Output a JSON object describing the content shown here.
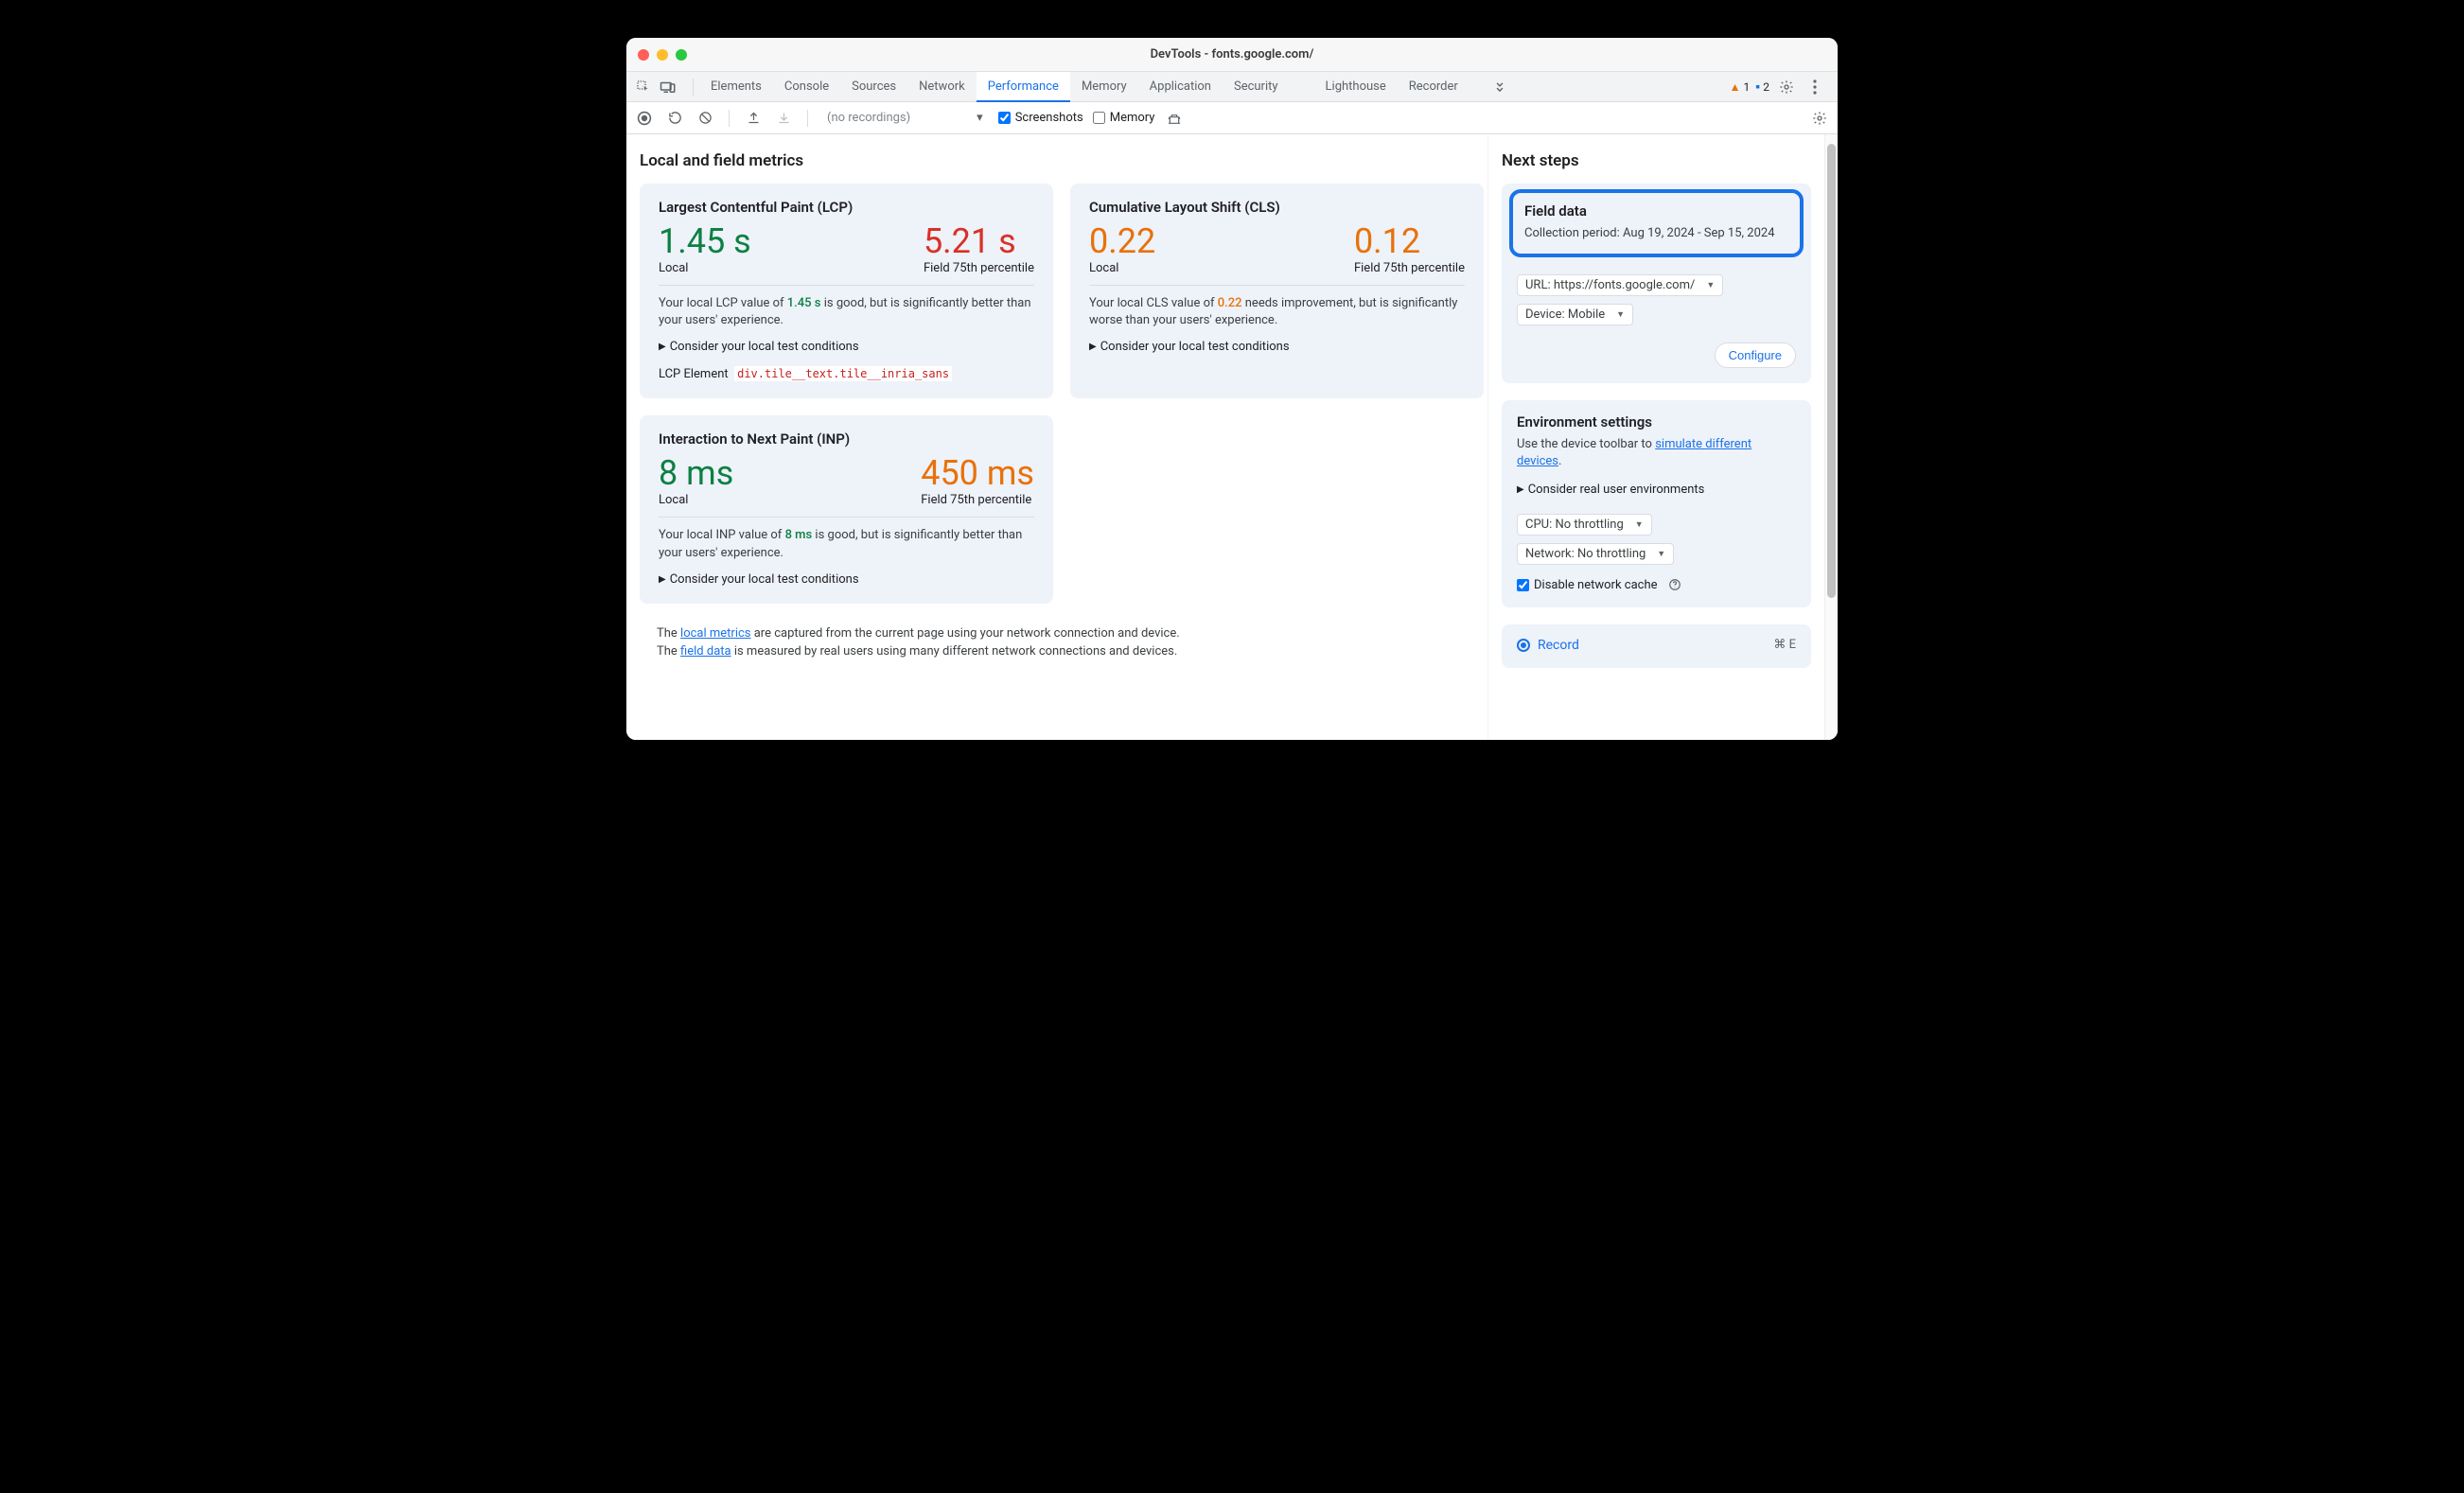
{
  "window": {
    "title": "DevTools - fonts.google.com/"
  },
  "tabs": {
    "items": [
      "Elements",
      "Console",
      "Sources",
      "Network",
      "Performance",
      "Memory",
      "Application",
      "Security",
      "Lighthouse",
      "Recorder"
    ],
    "active_index": 4,
    "warn_count": "1",
    "info_count": "2"
  },
  "toolbar": {
    "recordings_placeholder": "(no recordings)",
    "screenshots_label": "Screenshots",
    "memory_label": "Memory"
  },
  "main": {
    "heading": "Local and field metrics",
    "lcp": {
      "title": "Largest Contentful Paint (LCP)",
      "local_value": "1.45 s",
      "local_label": "Local",
      "field_value": "5.21 s",
      "field_label": "Field 75th percentile",
      "desc_prefix": "Your local LCP value of ",
      "desc_value": "1.45 s",
      "desc_suffix": " is good, but is significantly better than your users' experience.",
      "consider": "Consider your local test conditions",
      "lcp_elem_label": "LCP Element",
      "lcp_elem_sel": "div.tile__text.tile__inria_sans"
    },
    "cls": {
      "title": "Cumulative Layout Shift (CLS)",
      "local_value": "0.22",
      "local_label": "Local",
      "field_value": "0.12",
      "field_label": "Field 75th percentile",
      "desc_prefix": "Your local CLS value of ",
      "desc_value": "0.22",
      "desc_suffix": " needs improvement, but is significantly worse than your users' experience.",
      "consider": "Consider your local test conditions"
    },
    "inp": {
      "title": "Interaction to Next Paint (INP)",
      "local_value": "8 ms",
      "local_label": "Local",
      "field_value": "450 ms",
      "field_label": "Field 75th percentile",
      "desc_prefix": "Your local INP value of ",
      "desc_value": "8 ms",
      "desc_suffix": " is good, but is significantly better than your users' experience.",
      "consider": "Consider your local test conditions"
    },
    "footer": {
      "line1_a": "The ",
      "line1_link": "local metrics",
      "line1_b": " are captured from the current page using your network connection and device.",
      "line2_a": "The ",
      "line2_link": "field data",
      "line2_b": " is measured by real users using many different network connections and devices."
    }
  },
  "sidebar": {
    "heading": "Next steps",
    "field_data": {
      "title": "Field data",
      "period_label": "Collection period: ",
      "period_value": "Aug 19, 2024 - Sep 15, 2024",
      "url_select": "URL: https://fonts.google.com/",
      "device_select": "Device: Mobile",
      "configure": "Configure"
    },
    "env": {
      "title": "Environment settings",
      "text_a": "Use the device toolbar to ",
      "text_link": "simulate different devices",
      "text_b": ".",
      "consider": "Consider real user environments",
      "cpu_select": "CPU: No throttling",
      "net_select": "Network: No throttling",
      "disable_cache": "Disable network cache"
    },
    "record": {
      "label": "Record",
      "shortcut": "⌘ E"
    }
  }
}
